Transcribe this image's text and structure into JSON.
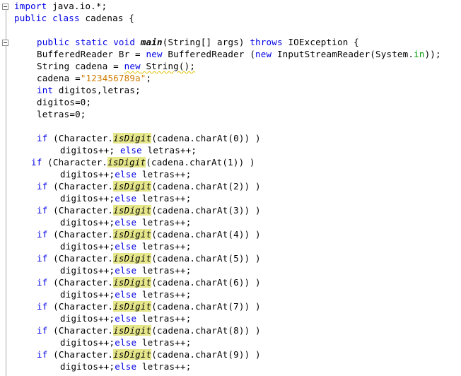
{
  "lines": [
    [
      {
        "t": "import",
        "c": "kw"
      },
      {
        "t": " java.io.*;"
      }
    ],
    [
      {
        "t": "public",
        "c": "kw"
      },
      {
        "t": " "
      },
      {
        "t": "class",
        "c": "kw"
      },
      {
        "t": " cadenas {"
      }
    ],
    [],
    [
      {
        "t": "public",
        "c": "kw"
      },
      {
        "t": " "
      },
      {
        "t": "static",
        "c": "kw"
      },
      {
        "t": " "
      },
      {
        "t": "void",
        "c": "kw"
      },
      {
        "t": " "
      },
      {
        "t": "main",
        "c": "mb"
      },
      {
        "t": "(String[] args) "
      },
      {
        "t": "throws",
        "c": "kw"
      },
      {
        "t": " IOException {"
      }
    ],
    [
      {
        "t": "BufferedReader Br = "
      },
      {
        "t": "new",
        "c": "kw"
      },
      {
        "t": " BufferedReader ("
      },
      {
        "t": "new",
        "c": "kw"
      },
      {
        "t": " InputStreamReader(System."
      },
      {
        "t": "in",
        "c": "fld"
      },
      {
        "t": "));"
      }
    ],
    [
      {
        "t": "String cadena = "
      },
      {
        "t": "new",
        "c": "kw sq"
      },
      {
        "t": " String();",
        "c": "sq"
      }
    ],
    [
      {
        "t": "cadena ="
      },
      {
        "t": "\"123456789a\"",
        "c": "str"
      },
      {
        "t": ";"
      }
    ],
    [
      {
        "t": "int",
        "c": "kw"
      },
      {
        "t": " digitos,letras;"
      }
    ],
    [
      {
        "t": "digitos=0;"
      }
    ],
    [
      {
        "t": "letras=0;"
      }
    ],
    [],
    [
      {
        "t": "if",
        "c": "kw"
      },
      {
        "t": " (Character."
      },
      {
        "t": "isDigit",
        "c": "hl"
      },
      {
        "t": "(cadena.charAt(0)) )"
      }
    ],
    [
      {
        "t": "digitos++; "
      },
      {
        "t": "else",
        "c": "kw"
      },
      {
        "t": " letras++;"
      }
    ],
    [
      {
        "t": "if",
        "c": "kw"
      },
      {
        "t": " (Character."
      },
      {
        "t": "isDigit",
        "c": "hl"
      },
      {
        "t": "(cadena.charAt(1)) )"
      }
    ],
    [
      {
        "t": "digitos++;"
      },
      {
        "t": "else",
        "c": "kw"
      },
      {
        "t": " letras++;"
      }
    ],
    [
      {
        "t": "if",
        "c": "kw"
      },
      {
        "t": " (Character."
      },
      {
        "t": "isDigit",
        "c": "hl"
      },
      {
        "t": "(cadena.charAt(2)) )"
      }
    ],
    [
      {
        "t": "digitos++;"
      },
      {
        "t": "else",
        "c": "kw"
      },
      {
        "t": " letras++;"
      }
    ],
    [
      {
        "t": "if",
        "c": "kw"
      },
      {
        "t": " (Character."
      },
      {
        "t": "isDigit",
        "c": "hl"
      },
      {
        "t": "(cadena.charAt(3)) )"
      }
    ],
    [
      {
        "t": "digitos++;"
      },
      {
        "t": "else",
        "c": "kw"
      },
      {
        "t": " letras++;"
      }
    ],
    [
      {
        "t": "if",
        "c": "kw"
      },
      {
        "t": " (Character."
      },
      {
        "t": "isDigit",
        "c": "hl"
      },
      {
        "t": "(cadena.charAt(4)) )"
      }
    ],
    [
      {
        "t": "digitos++;"
      },
      {
        "t": "else",
        "c": "kw"
      },
      {
        "t": " letras++;"
      }
    ],
    [
      {
        "t": "if",
        "c": "kw"
      },
      {
        "t": " (Character."
      },
      {
        "t": "isDigit",
        "c": "hl"
      },
      {
        "t": "(cadena.charAt(5)) )"
      }
    ],
    [
      {
        "t": "digitos++;"
      },
      {
        "t": "else",
        "c": "kw"
      },
      {
        "t": " letras++;"
      }
    ],
    [
      {
        "t": "if",
        "c": "kw"
      },
      {
        "t": " (Character."
      },
      {
        "t": "isDigit",
        "c": "hl"
      },
      {
        "t": "(cadena.charAt(6)) )"
      }
    ],
    [
      {
        "t": "digitos++;"
      },
      {
        "t": "else",
        "c": "kw"
      },
      {
        "t": " letras++;"
      }
    ],
    [
      {
        "t": "if",
        "c": "kw"
      },
      {
        "t": " (Character."
      },
      {
        "t": "isDigit",
        "c": "hl"
      },
      {
        "t": "(cadena.charAt(7)) )"
      }
    ],
    [
      {
        "t": "digitos++;"
      },
      {
        "t": "else",
        "c": "kw"
      },
      {
        "t": " letras++;"
      }
    ],
    [
      {
        "t": "if",
        "c": "kw"
      },
      {
        "t": " (Character."
      },
      {
        "t": "isDigit",
        "c": "hl"
      },
      {
        "t": "(cadena.charAt(8)) )"
      }
    ],
    [
      {
        "t": "digitos++;"
      },
      {
        "t": "else",
        "c": "kw"
      },
      {
        "t": " letras++;"
      }
    ],
    [
      {
        "t": "if",
        "c": "kw"
      },
      {
        "t": " (Character."
      },
      {
        "t": "isDigit",
        "c": "hl"
      },
      {
        "t": "(cadena.charAt(9)) )"
      }
    ],
    [
      {
        "t": "digitos++;"
      },
      {
        "t": "else",
        "c": "kw"
      },
      {
        "t": " letras++;"
      }
    ]
  ],
  "colors": {
    "keyword": "#0000e6",
    "string": "#ce7b00",
    "field": "#009900",
    "highlight": "#e6e68a",
    "text": "#000000"
  },
  "icons": [
    "fold-minus-icon"
  ]
}
